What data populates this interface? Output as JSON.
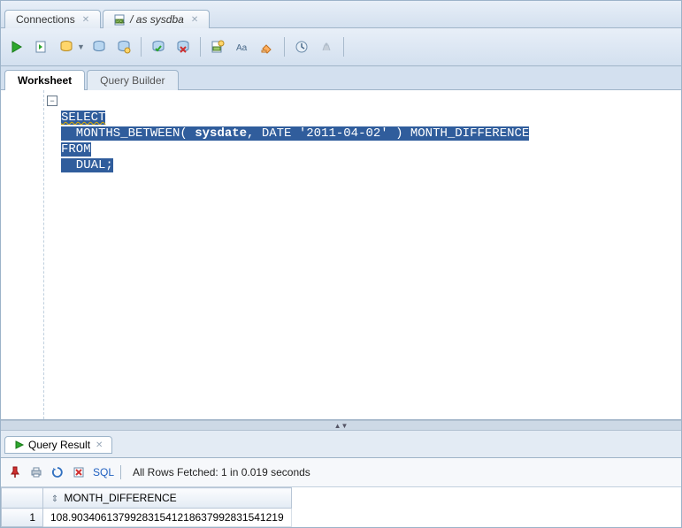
{
  "tabs": {
    "connections": {
      "label": "Connections"
    },
    "session": {
      "label": "/ as sysdba"
    }
  },
  "worksheet_tabs": {
    "ws": "Worksheet",
    "qb": "Query Builder"
  },
  "sql": {
    "l1a": "SELECT",
    "l2": "  MONTHS_BETWEEN( sysdate, DATE '2011-04-02' ) MONTH_DIFFERENCE",
    "l3": "FROM",
    "l4": "  DUAL;"
  },
  "result": {
    "tab_label": "Query Result",
    "sql_link": "SQL",
    "status": "All Rows Fetched: 1 in 0.019 seconds",
    "column": "MONTH_DIFFERENCE",
    "row_num": "1",
    "value": "108.903406137992831541218637992831541219"
  }
}
